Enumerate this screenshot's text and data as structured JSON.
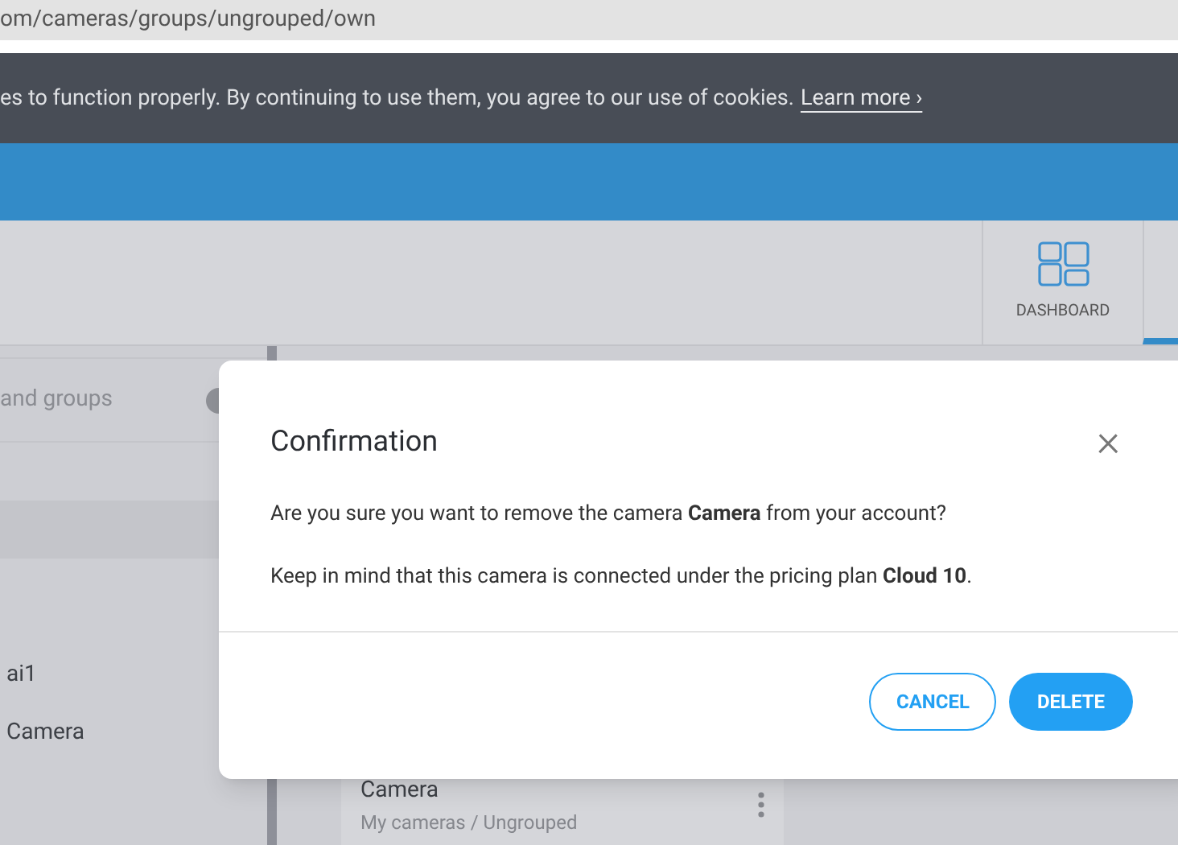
{
  "address_bar": {
    "url": "om/cameras/groups/ungrouped/own"
  },
  "cookie_banner": {
    "text": "es to function properly. By continuing to use them, you agree to our use of cookies.",
    "link": "Learn more ›"
  },
  "header": {
    "nav": [
      {
        "label": "DASHBOARD",
        "selected": false
      },
      {
        "selected": true
      }
    ]
  },
  "sidebar": {
    "search": {
      "placeholder": "and groups"
    },
    "items": [
      {
        "selected": true
      },
      {
        "label": "ai1",
        "selected": false
      },
      {
        "label": "Camera",
        "selected": false
      }
    ]
  },
  "camera_card": {
    "name": "Camera",
    "path": "My cameras / Ungrouped"
  },
  "dialog": {
    "title": "Confirmation",
    "close": "×",
    "paragraphs": [
      "Are you sure you want to remove the camera **Camera** from your account?",
      "Keep in mind that this camera is connected under the pricing plan **Cloud 10**."
    ],
    "buttons": [
      {
        "label": "CANCEL",
        "kind": "secondary"
      },
      {
        "label": "DELETE",
        "kind": "primary"
      }
    ]
  }
}
